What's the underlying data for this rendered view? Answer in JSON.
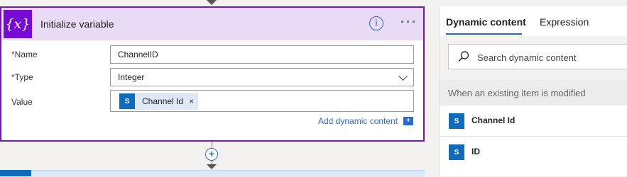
{
  "card": {
    "title": "Initialize variable",
    "icon_text": "{x}",
    "info_glyph": "i",
    "more_glyph": "···",
    "fields": {
      "name": {
        "label": "Name",
        "value": "ChannelID",
        "required": "*"
      },
      "type": {
        "label": "Type",
        "value": "Integer",
        "required": "*"
      },
      "value": {
        "label": "Value",
        "token": {
          "label": "Channel Id",
          "remove": "×",
          "icon": "sharepoint-icon",
          "icon_text": "S"
        }
      }
    },
    "add_dynamic": "Add dynamic content",
    "add_dynamic_icon_text": "+"
  },
  "flow": {
    "add_step_glyph": "+"
  },
  "panel": {
    "tabs": [
      "Dynamic content",
      "Expression"
    ],
    "active_tab": "Dynamic content",
    "search_placeholder": "Search dynamic content",
    "group_title": "When an existing item is modified",
    "items": [
      {
        "label": "Channel Id",
        "icon": "sharepoint-icon",
        "icon_text": "S"
      },
      {
        "label": "ID",
        "icon": "sharepoint-icon",
        "icon_text": "S"
      }
    ]
  },
  "colors": {
    "accent": "#2b6ac8",
    "card_border": "#7219a8",
    "header_bg": "#e9dbf5",
    "variable_icon": "#770bd6",
    "sharepoint": "#0f6cbd"
  }
}
